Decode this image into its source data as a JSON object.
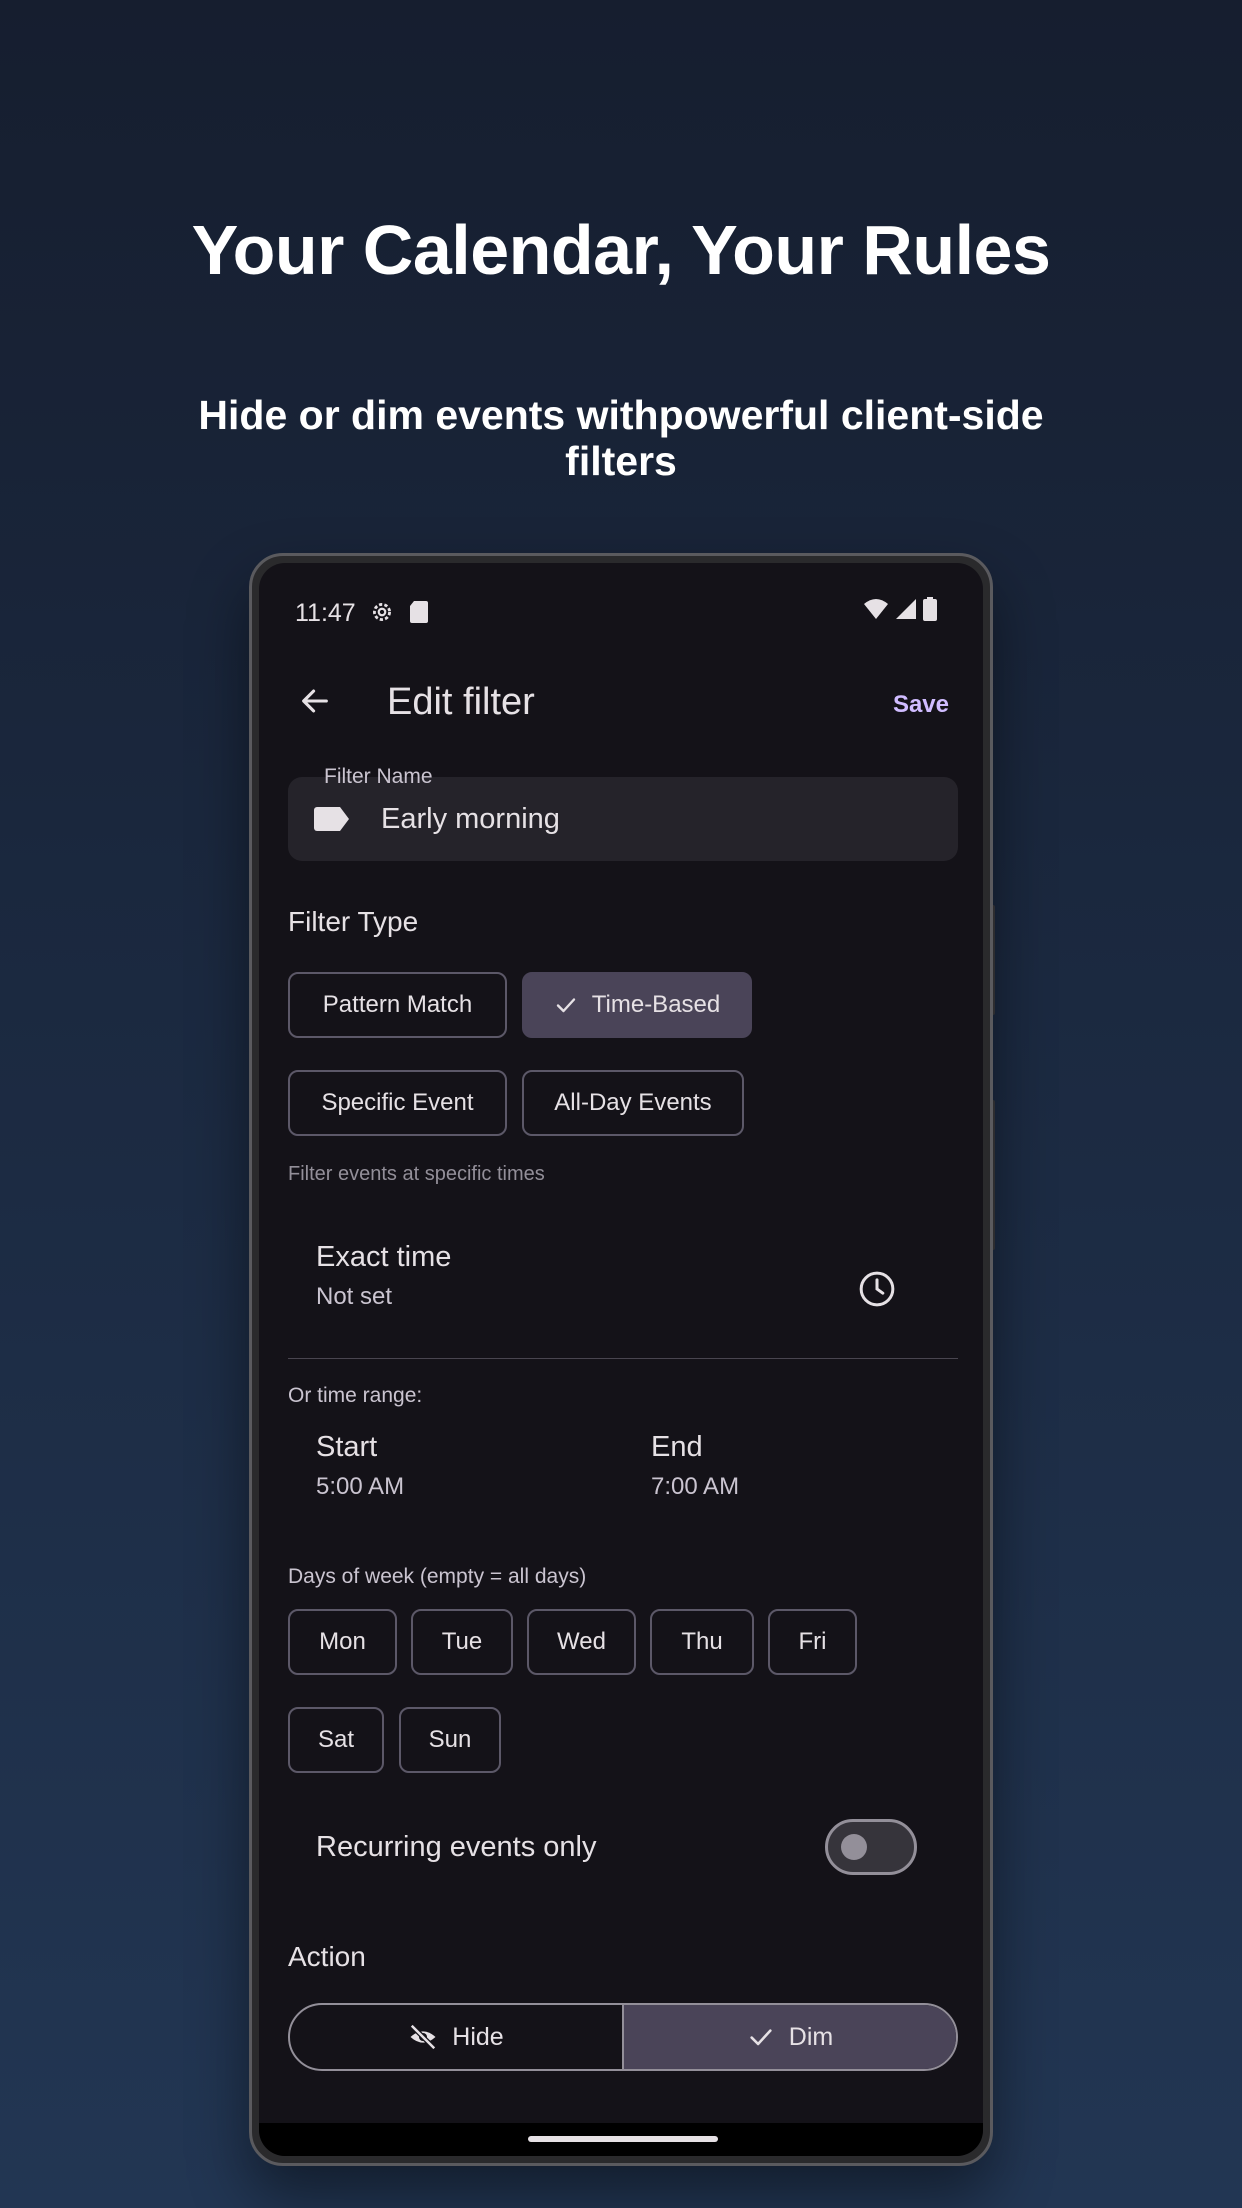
{
  "promo": {
    "headline": "Your Calendar, Your Rules",
    "subhead": "Hide or dim events withpowerful client-side filters"
  },
  "status_bar": {
    "time": "11:47",
    "icons": [
      "settings-gear-icon",
      "sd-card-icon",
      "wifi-icon",
      "cell-signal-icon",
      "battery-icon"
    ]
  },
  "app_bar": {
    "back_icon": "arrow-back-icon",
    "title": "Edit filter",
    "save_label": "Save"
  },
  "filter_name": {
    "label": "Filter Name",
    "value": "Early morning",
    "icon": "label-tag-icon"
  },
  "filter_type": {
    "heading": "Filter Type",
    "chips": [
      {
        "label": "Pattern Match",
        "selected": false
      },
      {
        "label": "Time-Based",
        "selected": true
      },
      {
        "label": "Specific Event",
        "selected": false
      },
      {
        "label": "All-Day Events",
        "selected": false
      }
    ],
    "helper": "Filter events at specific times"
  },
  "exact_time": {
    "title": "Exact time",
    "value": "Not set",
    "icon": "clock-icon"
  },
  "time_range": {
    "label": "Or time range:",
    "start_label": "Start",
    "start_value": "5:00 AM",
    "end_label": "End",
    "end_value": "7:00 AM"
  },
  "days": {
    "label": "Days of week (empty = all days)",
    "items": [
      "Mon",
      "Tue",
      "Wed",
      "Thu",
      "Fri",
      "Sat",
      "Sun"
    ]
  },
  "recurring": {
    "label": "Recurring events only",
    "on": false
  },
  "action": {
    "heading": "Action",
    "options": [
      {
        "label": "Hide",
        "icon": "visibility-off-icon",
        "selected": false
      },
      {
        "label": "Dim",
        "icon": "check-icon",
        "selected": true
      }
    ]
  },
  "colors": {
    "accent": "#d0bcff",
    "selected_bg": "#4a4458",
    "surface": "#141218"
  }
}
